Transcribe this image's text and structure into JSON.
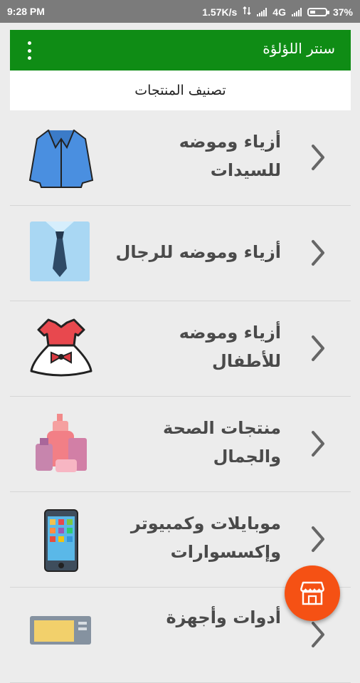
{
  "status_bar": {
    "time": "9:28 PM",
    "speed": "1.57K/s",
    "network": "4G",
    "battery": "37%",
    "battery_level": 0.37
  },
  "app_bar": {
    "title": "سنتر اللؤلؤة"
  },
  "subheader": {
    "title": "تصنيف المنتجات"
  },
  "categories": [
    {
      "line1": "أزياء وموضه",
      "line2": "للسيدات",
      "icon": "women-jacket-icon"
    },
    {
      "line1": "أزياء وموضه للرجال",
      "line2": "",
      "icon": "men-shirt-tie-icon"
    },
    {
      "line1": "أزياء وموضه",
      "line2": "للأطفال",
      "icon": "kids-dress-icon"
    },
    {
      "line1": "منتجات الصحة",
      "line2": "والجمال",
      "icon": "cosmetics-icon"
    },
    {
      "line1": "موبايلات وكمبيوتر",
      "line2": "وإكسسوارات",
      "icon": "smartphone-icon"
    },
    {
      "line1": "أدوات وأجهزة",
      "line2": "",
      "icon": "appliance-icon"
    }
  ],
  "fab": {
    "icon": "store-icon"
  }
}
